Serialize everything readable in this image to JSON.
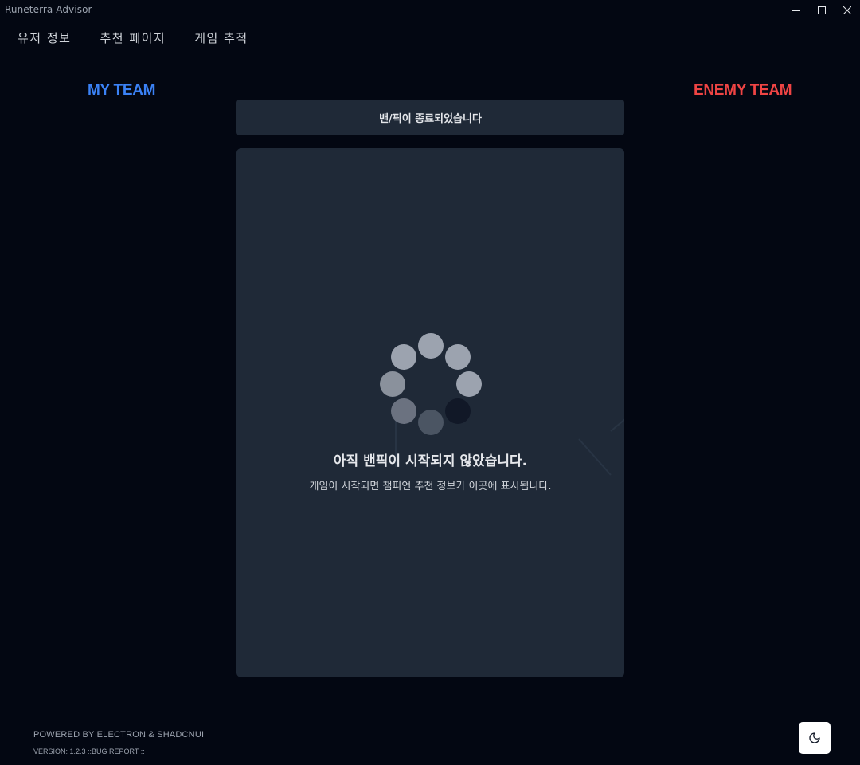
{
  "window": {
    "title": "Runeterra Advisor",
    "controls": [
      "minimize-icon",
      "maximize-icon",
      "close-icon"
    ]
  },
  "nav": {
    "items": [
      {
        "label": "유저 정보"
      },
      {
        "label": "추천 페이지"
      },
      {
        "label": "게임 추적"
      }
    ]
  },
  "teams": {
    "my_team": "MY TEAM",
    "enemy_team": "ENEMY TEAM",
    "my_team_color": "#3b82f6",
    "enemy_team_color": "#ef4444"
  },
  "status": {
    "text": "밴/픽이 종료되었습니다"
  },
  "main": {
    "spinner_icon": "loading-spinner-icon",
    "empty_title": "아직 밴픽이 시작되지 않았습니다.",
    "empty_subtitle": "게임이 시작되면 챔피언 추천 정보가 이곳에 표시됩니다."
  },
  "footer": {
    "powered": "POWERED BY ELECTRON & SHADCNUI",
    "version": "VERSION: 1.2.3 ::BUG REPORT ::",
    "theme_toggle_icon": "moon-icon"
  },
  "colors": {
    "background": "#030712",
    "panel": "#1f2937"
  }
}
